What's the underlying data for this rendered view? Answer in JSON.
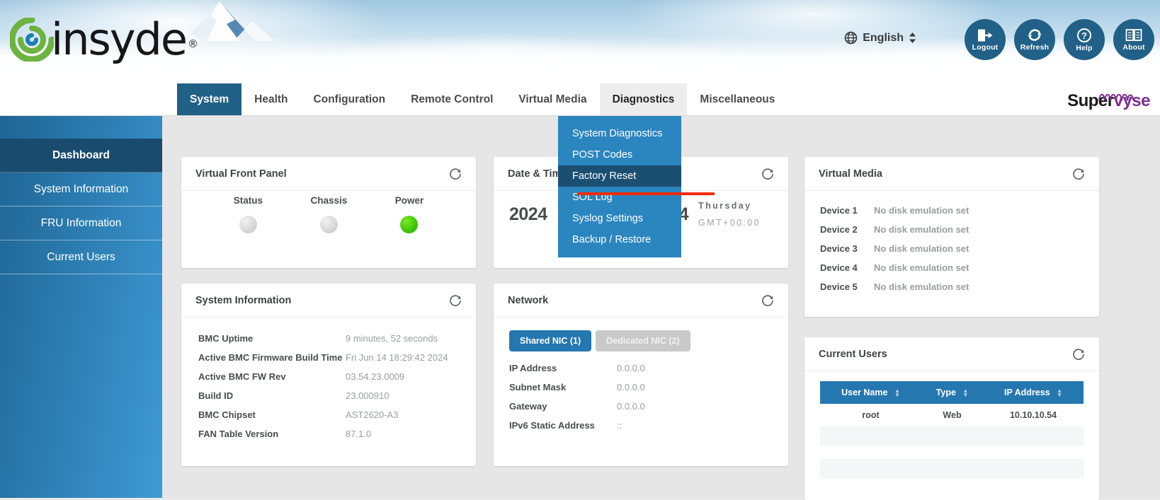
{
  "header": {
    "logo_text": "insyde",
    "logo_trademark": "®",
    "logo_mark_icon": "insyde-swirl-icon",
    "language": {
      "label": "English",
      "globe_icon": "globe-icon",
      "caret_icon": "up-down-caret-icon"
    },
    "buttons": [
      {
        "label": "Logout",
        "icon": "logout-icon"
      },
      {
        "label": "Refresh",
        "icon": "refresh-icon"
      },
      {
        "label": "Help",
        "icon": "question-circle-icon"
      },
      {
        "label": "About",
        "icon": "book-icon"
      }
    ]
  },
  "nav": {
    "items": [
      {
        "label": "System",
        "state": "active"
      },
      {
        "label": "Health",
        "state": "normal"
      },
      {
        "label": "Configuration",
        "state": "normal"
      },
      {
        "label": "Remote Control",
        "state": "normal"
      },
      {
        "label": "Virtual Media",
        "state": "normal"
      },
      {
        "label": "Diagnostics",
        "state": "hover"
      },
      {
        "label": "Miscellaneous",
        "state": "normal"
      }
    ],
    "brand": {
      "part1": "Super",
      "part2": "vyse",
      "squiggle_icon": "squiggle-icon"
    }
  },
  "dropdown": {
    "parent": "Diagnostics",
    "items": [
      {
        "label": "System Diagnostics",
        "active": false
      },
      {
        "label": "POST Codes",
        "active": false
      },
      {
        "label": "Factory Reset",
        "active": true
      },
      {
        "label": "SOL Log",
        "active": false
      },
      {
        "label": "Syslog Settings",
        "active": false
      },
      {
        "label": "Backup / Restore",
        "active": false
      }
    ],
    "annotation_color": "#f52b00"
  },
  "sidebar": {
    "items": [
      {
        "label": "Dashboard",
        "active": true
      },
      {
        "label": "System Information",
        "active": false
      },
      {
        "label": "FRU Information",
        "active": false
      },
      {
        "label": "Current Users",
        "active": false
      }
    ]
  },
  "cards": {
    "virtual_front_panel": {
      "title": "Virtual Front Panel",
      "refresh_icon": "refresh-icon",
      "indicators": [
        {
          "label": "Status",
          "color": "#d3d3d3",
          "state": "gray"
        },
        {
          "label": "Chassis",
          "color": "#d3d3d3",
          "state": "gray"
        },
        {
          "label": "Power",
          "color": "#34c406",
          "state": "green"
        }
      ]
    },
    "date_time": {
      "title": "Date & Time",
      "refresh_icon": "refresh-icon",
      "date_value": "2024",
      "date_value_tail": "4",
      "weekday": "Thursday",
      "timezone": "GMT+00:00"
    },
    "virtual_media": {
      "title": "Virtual Media",
      "refresh_icon": "refresh-icon",
      "rows": [
        {
          "key": "Device 1",
          "value": "No disk emulation set"
        },
        {
          "key": "Device 2",
          "value": "No disk emulation set"
        },
        {
          "key": "Device 3",
          "value": "No disk emulation set"
        },
        {
          "key": "Device 4",
          "value": "No disk emulation set"
        },
        {
          "key": "Device 5",
          "value": "No disk emulation set"
        }
      ]
    },
    "system_information": {
      "title": "System Information",
      "refresh_icon": "refresh-icon",
      "rows": [
        {
          "key": "BMC Uptime",
          "value": "9 minutes, 52 seconds"
        },
        {
          "key": "Active BMC Firmware Build Time",
          "value": "Fri Jun 14 18:29:42 2024"
        },
        {
          "key": "Active BMC FW Rev",
          "value": "03.54.23.0009"
        },
        {
          "key": "Build ID",
          "value": "23.000910"
        },
        {
          "key": "BMC Chipset",
          "value": "AST2620-A3"
        },
        {
          "key": "FAN Table Version",
          "value": "87.1.0"
        }
      ]
    },
    "network": {
      "title": "Network",
      "refresh_icon": "refresh-icon",
      "nic_tabs": [
        {
          "label": "Shared NIC (1)",
          "selected": true
        },
        {
          "label": "Dedicated NIC (2)",
          "selected": false
        }
      ],
      "rows": [
        {
          "key": "IP Address",
          "value": "0.0.0.0"
        },
        {
          "key": "Subnet Mask",
          "value": "0.0.0.0"
        },
        {
          "key": "Gateway",
          "value": "0.0.0.0"
        },
        {
          "key": "IPv6 Static Address",
          "value": "::"
        }
      ]
    },
    "current_users": {
      "title": "Current Users",
      "refresh_icon": "refresh-icon",
      "columns": [
        "User Name",
        "Type",
        "IP Address"
      ],
      "rows": [
        {
          "user_name": "root",
          "type": "Web",
          "ip_address": "10.10.10.54"
        }
      ]
    }
  },
  "colors": {
    "accent_blue": "#2577b0",
    "nav_active": "#216087",
    "sidebar_active": "#184b6e",
    "menu_blue": "#2b85bf",
    "menu_active": "#1b4f72",
    "led_green": "#34c406",
    "annotation_red": "#f52b00",
    "brand_purple": "#7c2f8f"
  }
}
